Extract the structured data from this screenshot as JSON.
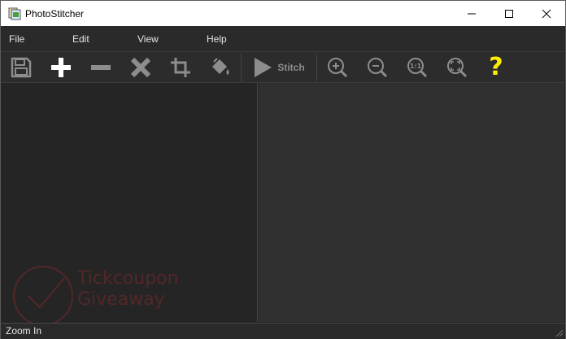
{
  "window": {
    "title": "PhotoStitcher",
    "icon": "photostitcher-app-icon"
  },
  "menu": {
    "items": [
      "File",
      "Edit",
      "View",
      "Help"
    ]
  },
  "toolbar": {
    "buttons": [
      {
        "name": "save",
        "icon": "floppy-disk-icon"
      },
      {
        "name": "add",
        "icon": "plus-icon"
      },
      {
        "name": "remove",
        "icon": "minus-icon"
      },
      {
        "name": "clear",
        "icon": "x-icon"
      },
      {
        "name": "crop",
        "icon": "crop-icon"
      },
      {
        "name": "fill",
        "icon": "paint-bucket-icon"
      },
      {
        "name": "stitch",
        "icon": "play-icon",
        "label": "Stitch"
      },
      {
        "name": "zoom-in",
        "icon": "zoom-in-icon"
      },
      {
        "name": "zoom-out",
        "icon": "zoom-out-icon"
      },
      {
        "name": "actual-size",
        "icon": "zoom-1to1-icon",
        "label": "1:1"
      },
      {
        "name": "fit",
        "icon": "zoom-fit-icon"
      },
      {
        "name": "help",
        "icon": "question-icon",
        "label": "?"
      }
    ]
  },
  "status": {
    "text": "Zoom In"
  },
  "watermark": {
    "line1": "Tickcoupon",
    "line2": "Giveaway"
  },
  "colors": {
    "accent_help": "#ffee00",
    "icon_white": "#ffffff",
    "icon_gray": "#8d8d8d",
    "watermark": "#7a2a2a"
  }
}
